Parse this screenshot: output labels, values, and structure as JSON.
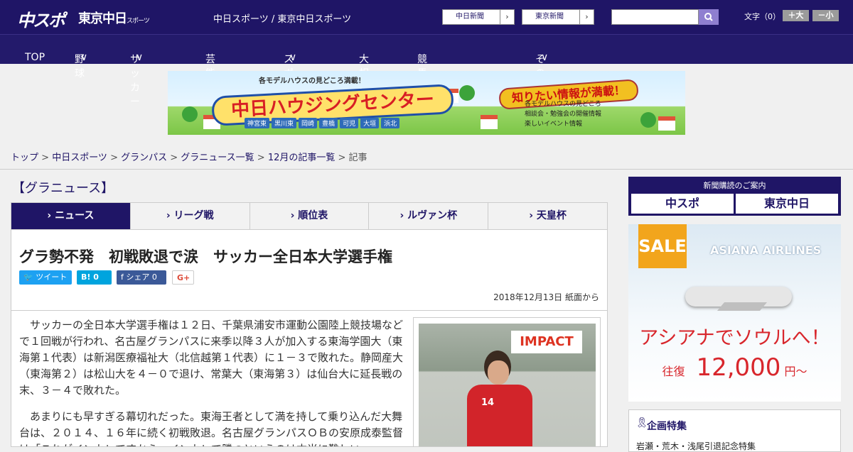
{
  "header": {
    "logo_main": "中スポ",
    "logo_sub": "東京中日",
    "logo_sub_small": "スポーツ",
    "site_name": "中日スポーツ / 東京中日スポーツ",
    "link_chunichi": "中日新聞",
    "link_tokyo": "東京新聞",
    "search_placeholder": "",
    "font_size_label": "文字（0）",
    "font_bigger": "＋大",
    "font_smaller": "－小"
  },
  "nav": {
    "items": [
      {
        "label": "TOP"
      },
      {
        "label": "野球"
      },
      {
        "label": "サッカー"
      },
      {
        "label": "芸能・社会"
      },
      {
        "label": "スポーツ"
      },
      {
        "label": "大相撲"
      },
      {
        "label": "競馬・ボート・競輪"
      },
      {
        "label": "その他"
      }
    ]
  },
  "banner": {
    "headline": "各モデルハウスの見どころ満載！",
    "title": "中日ハウジングセンター",
    "towns": [
      "神宮東",
      "黒川東",
      "岡崎",
      "豊橋",
      "可児",
      "大垣",
      "浜北"
    ],
    "tag": "知りたい情報が満載！",
    "list": [
      "各モデルハウスの見どころ",
      "相談会・勉強会の開催情報",
      "楽しいイベント情報"
    ]
  },
  "breadcrumb": {
    "items": [
      "トップ",
      "中日スポーツ",
      "グランパス",
      "グラニュース一覧",
      "12月の記事一覧"
    ],
    "current": "記事",
    "sep": " > "
  },
  "section_title": "【グラニュース】",
  "tabs": [
    {
      "label": "› ニュース"
    },
    {
      "label": "› リーグ戦"
    },
    {
      "label": "› 順位表"
    },
    {
      "label": "› ルヴァン杯"
    },
    {
      "label": "› 天皇杯"
    }
  ],
  "article": {
    "headline": "グラ勢不発　初戦敗退で涙　サッカー全日本大学選手権",
    "share_tweet": "ツイート",
    "share_hatena": "B! 0",
    "share_fb": "シェア 0",
    "share_gplus": "G+",
    "date": "2018年12月13日 紙面から",
    "para1": "サッカーの全日本大学選手権は１２日、千葉県浦安市運動公園陸上競技場などで１回戦が行われ、名古屋グランパスに来季以降３人が加入する東海学園大（東海第１代表）は新潟医療福祉大（北信越第１代表）に１－３で敗れた。静岡産大（東海第２）は松山大を４－０で退け、常葉大（東海第３）は仙台大に延長戦の末、３－４で敗れた。",
    "para2": "あまりにも早すぎる幕切れだった。東海王者として満を持して乗り込んだ大舞台は、２０１４、１６年に続く初戦敗退。名古屋グランパスＯＢの安原成泰監督は「これがインカレですから。インカレで勝つというのは本当に難しい」",
    "photo_sign": "IMPACT",
    "photo_number": "14"
  },
  "sidebar": {
    "subscribe_title": "新聞購読のご案内",
    "subscribe_a": "中スポ",
    "subscribe_b": "東京中日",
    "ad_sale": "SALE",
    "ad_airline": "ASIANA AIRLINES",
    "ad_catch": "アシアナでソウルへ！",
    "ad_price_prefix": "往復",
    "ad_price": "12,000",
    "ad_price_suffix": "円～",
    "feature_title": "企画特集",
    "feature_item": "岩瀬・荒木・浅尾引退記念特集"
  }
}
